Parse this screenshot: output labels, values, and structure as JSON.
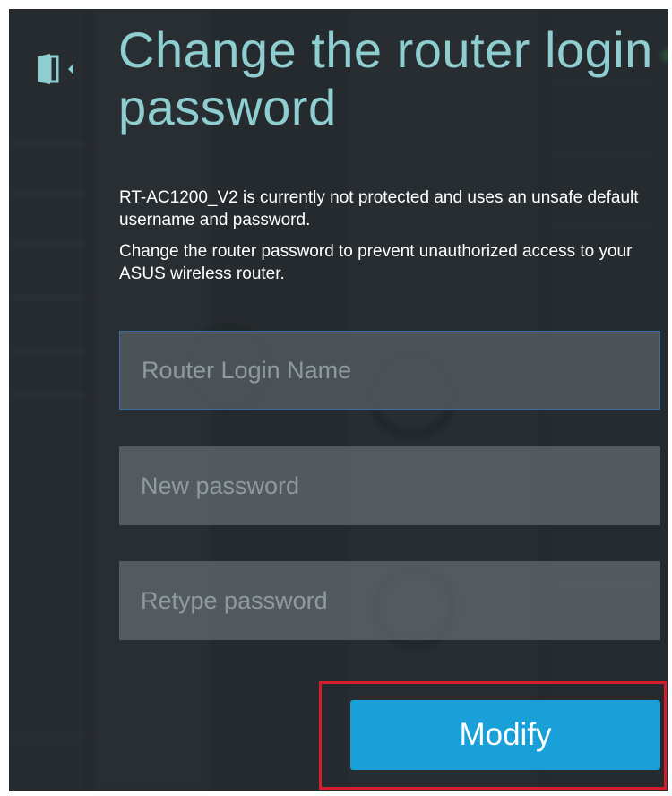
{
  "dialog": {
    "title": "Change the router login password",
    "description_1": "RT-AC1200_V2 is currently not protected and uses an unsafe default username and password.",
    "description_2": "Change the router password to prevent unauthorized access to your ASUS wireless router."
  },
  "form": {
    "login_name_placeholder": "Router Login Name",
    "new_password_placeholder": "New password",
    "retype_password_placeholder": "Retype password",
    "modify_label": "Modify"
  },
  "icons": {
    "header_icon": "door-exit-icon"
  },
  "colors": {
    "title": "#8ecdd0",
    "button": "#1aa0d8",
    "highlight": "#d51d2b",
    "focus_border": "#3a6da8"
  }
}
